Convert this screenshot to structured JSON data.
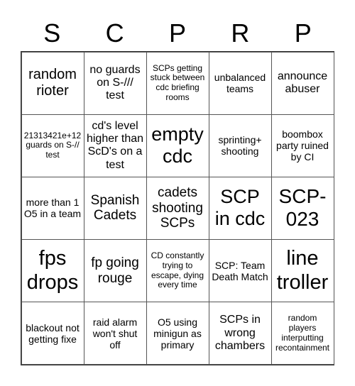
{
  "header": {
    "letters": [
      "S",
      "C",
      "P",
      "R",
      "P"
    ]
  },
  "board": {
    "rows": [
      [
        "random rioter",
        "no guards on S-/// test",
        "SCPs getting stuck between cdc briefing rooms",
        "unbalanced teams",
        "announce abuser"
      ],
      [
        "21313421e+12 guards on S-// test",
        "cd's level higher than ScD's on a test",
        "empty cdc",
        "sprinting+ shooting",
        "boombox party ruined by CI"
      ],
      [
        "more than 1 O5 in a team",
        "Spanish Cadets",
        "cadets shooting SCPs",
        "SCP in cdc",
        "SCP-023"
      ],
      [
        "fps drops",
        "fp going rouge",
        "CD constantly trying to escape, dying every time",
        "SCP: Team Death Match",
        "line troller"
      ],
      [
        "blackout not getting fixe",
        "raid alarm won't shut off",
        "O5 using minigun as primary",
        "SCPs in wrong chambers",
        "random players interputting recontainment"
      ]
    ]
  }
}
